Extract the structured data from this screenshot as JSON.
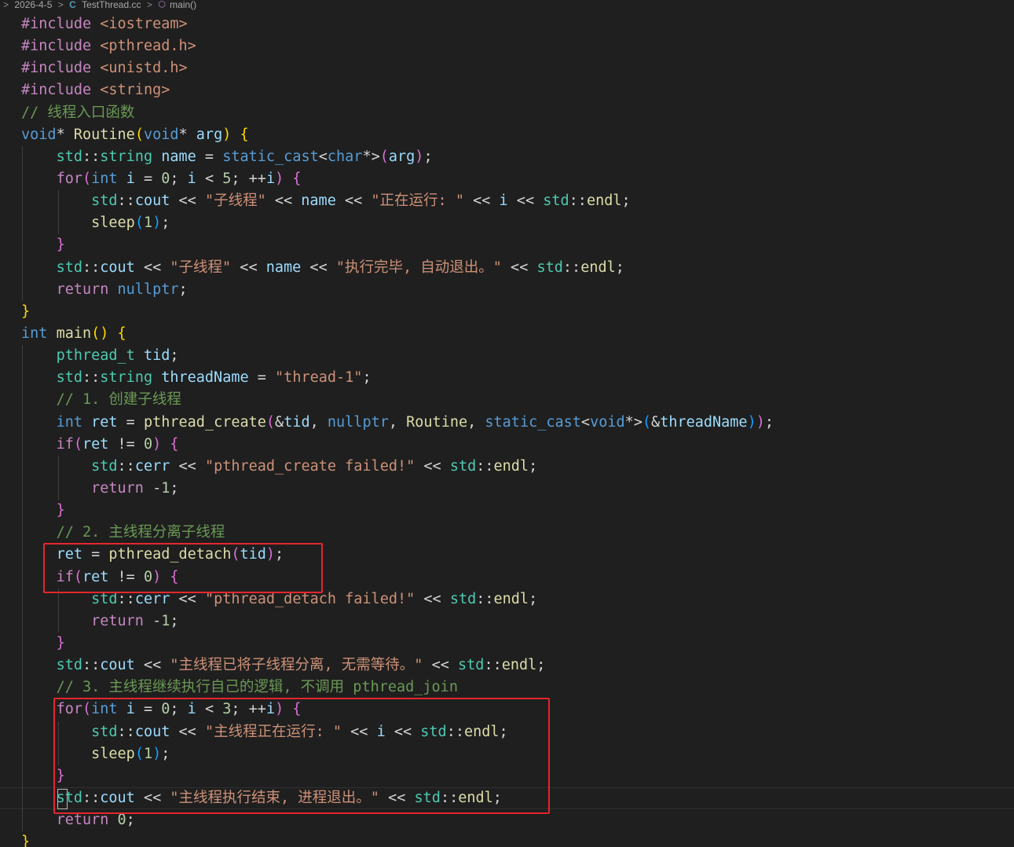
{
  "breadcrumb": {
    "items": [
      "2026-4-5",
      "TestThread.cc",
      "main()"
    ],
    "separator": ">"
  },
  "colors": {
    "background": "#1f1f1f",
    "highlight_box": "#e5262d",
    "comment": "#6a9955",
    "string": "#ce9178",
    "keyword": "#569cd6",
    "type": "#4ec9b0",
    "function": "#dcdcaa",
    "variable": "#9cdcfe"
  },
  "editor": {
    "language": "cpp",
    "lines": [
      {
        "indent": 0,
        "tokens": [
          [
            "pre",
            "#include "
          ],
          [
            "str",
            "<iostream>"
          ]
        ]
      },
      {
        "indent": 0,
        "tokens": [
          [
            "pre",
            "#include "
          ],
          [
            "str",
            "<pthread.h>"
          ]
        ]
      },
      {
        "indent": 0,
        "tokens": [
          [
            "pre",
            "#include "
          ],
          [
            "str",
            "<unistd.h>"
          ]
        ]
      },
      {
        "indent": 0,
        "tokens": [
          [
            "pre",
            "#include "
          ],
          [
            "str",
            "<string>"
          ]
        ]
      },
      {
        "indent": 0,
        "tokens": [
          [
            "cmt",
            "// 线程入口函数"
          ]
        ]
      },
      {
        "indent": 0,
        "tokens": [
          [
            "kw",
            "void"
          ],
          [
            "op",
            "* "
          ],
          [
            "fn",
            "Routine"
          ],
          [
            "p1",
            "("
          ],
          [
            "kw",
            "void"
          ],
          [
            "op",
            "* "
          ],
          [
            "var",
            "arg"
          ],
          [
            "p1",
            ")"
          ],
          [
            "pl",
            " "
          ],
          [
            "p1",
            "{"
          ]
        ]
      },
      {
        "indent": 1,
        "tokens": [
          [
            "type",
            "std"
          ],
          [
            "op",
            "::"
          ],
          [
            "type",
            "string"
          ],
          [
            "pl",
            " "
          ],
          [
            "var",
            "name"
          ],
          [
            "op",
            " = "
          ],
          [
            "kw",
            "static_cast"
          ],
          [
            "op",
            "<"
          ],
          [
            "kw",
            "char"
          ],
          [
            "op",
            "*>"
          ],
          [
            "p2",
            "("
          ],
          [
            "var",
            "arg"
          ],
          [
            "p2",
            ")"
          ],
          [
            "pl",
            ";"
          ]
        ]
      },
      {
        "indent": 1,
        "tokens": [
          [
            "ctl",
            "for"
          ],
          [
            "p2",
            "("
          ],
          [
            "kw",
            "int"
          ],
          [
            "pl",
            " "
          ],
          [
            "var",
            "i"
          ],
          [
            "op",
            " = "
          ],
          [
            "num",
            "0"
          ],
          [
            "pl",
            "; "
          ],
          [
            "var",
            "i"
          ],
          [
            "op",
            " < "
          ],
          [
            "num",
            "5"
          ],
          [
            "pl",
            "; "
          ],
          [
            "op",
            "++"
          ],
          [
            "var",
            "i"
          ],
          [
            "p2",
            ")"
          ],
          [
            "pl",
            " "
          ],
          [
            "p2",
            "{"
          ]
        ]
      },
      {
        "indent": 2,
        "tokens": [
          [
            "type",
            "std"
          ],
          [
            "op",
            "::"
          ],
          [
            "var",
            "cout"
          ],
          [
            "op",
            " << "
          ],
          [
            "str",
            "\"子线程\""
          ],
          [
            "op",
            " << "
          ],
          [
            "var",
            "name"
          ],
          [
            "op",
            " << "
          ],
          [
            "str",
            "\"正在运行: \""
          ],
          [
            "op",
            " << "
          ],
          [
            "var",
            "i"
          ],
          [
            "op",
            " << "
          ],
          [
            "type",
            "std"
          ],
          [
            "op",
            "::"
          ],
          [
            "fn",
            "endl"
          ],
          [
            "pl",
            ";"
          ]
        ]
      },
      {
        "indent": 2,
        "tokens": [
          [
            "fn",
            "sleep"
          ],
          [
            "p3",
            "("
          ],
          [
            "num",
            "1"
          ],
          [
            "p3",
            ")"
          ],
          [
            "pl",
            ";"
          ]
        ]
      },
      {
        "indent": 1,
        "tokens": [
          [
            "p2",
            "}"
          ]
        ]
      },
      {
        "indent": 1,
        "tokens": [
          [
            "type",
            "std"
          ],
          [
            "op",
            "::"
          ],
          [
            "var",
            "cout"
          ],
          [
            "op",
            " << "
          ],
          [
            "str",
            "\"子线程\""
          ],
          [
            "op",
            " << "
          ],
          [
            "var",
            "name"
          ],
          [
            "op",
            " << "
          ],
          [
            "str",
            "\"执行完毕, 自动退出。\""
          ],
          [
            "op",
            " << "
          ],
          [
            "type",
            "std"
          ],
          [
            "op",
            "::"
          ],
          [
            "fn",
            "endl"
          ],
          [
            "pl",
            ";"
          ]
        ]
      },
      {
        "indent": 1,
        "tokens": [
          [
            "ctl",
            "return"
          ],
          [
            "pl",
            " "
          ],
          [
            "kw",
            "nullptr"
          ],
          [
            "pl",
            ";"
          ]
        ]
      },
      {
        "indent": 0,
        "tokens": [
          [
            "p1",
            "}"
          ]
        ]
      },
      {
        "indent": 0,
        "tokens": [
          [
            "kw",
            "int"
          ],
          [
            "pl",
            " "
          ],
          [
            "fn",
            "main"
          ],
          [
            "p1",
            "()"
          ],
          [
            "pl",
            " "
          ],
          [
            "p1",
            "{"
          ]
        ]
      },
      {
        "indent": 1,
        "tokens": [
          [
            "type",
            "pthread_t"
          ],
          [
            "pl",
            " "
          ],
          [
            "var",
            "tid"
          ],
          [
            "pl",
            ";"
          ]
        ]
      },
      {
        "indent": 1,
        "tokens": [
          [
            "type",
            "std"
          ],
          [
            "op",
            "::"
          ],
          [
            "type",
            "string"
          ],
          [
            "pl",
            " "
          ],
          [
            "var",
            "threadName"
          ],
          [
            "op",
            " = "
          ],
          [
            "str",
            "\"thread-1\""
          ],
          [
            "pl",
            ";"
          ]
        ]
      },
      {
        "indent": 1,
        "tokens": [
          [
            "cmt",
            "// 1. 创建子线程"
          ]
        ]
      },
      {
        "indent": 1,
        "tokens": [
          [
            "kw",
            "int"
          ],
          [
            "pl",
            " "
          ],
          [
            "var",
            "ret"
          ],
          [
            "op",
            " = "
          ],
          [
            "fn",
            "pthread_create"
          ],
          [
            "p2",
            "("
          ],
          [
            "op",
            "&"
          ],
          [
            "var",
            "tid"
          ],
          [
            "pl",
            ", "
          ],
          [
            "kw",
            "nullptr"
          ],
          [
            "pl",
            ", "
          ],
          [
            "fn",
            "Routine"
          ],
          [
            "pl",
            ", "
          ],
          [
            "kw",
            "static_cast"
          ],
          [
            "op",
            "<"
          ],
          [
            "kw",
            "void"
          ],
          [
            "op",
            "*>"
          ],
          [
            "p3",
            "("
          ],
          [
            "op",
            "&"
          ],
          [
            "var",
            "threadName"
          ],
          [
            "p3",
            ")"
          ],
          [
            "p2",
            ")"
          ],
          [
            "pl",
            ";"
          ]
        ]
      },
      {
        "indent": 1,
        "tokens": [
          [
            "ctl",
            "if"
          ],
          [
            "p2",
            "("
          ],
          [
            "var",
            "ret"
          ],
          [
            "op",
            " != "
          ],
          [
            "num",
            "0"
          ],
          [
            "p2",
            ")"
          ],
          [
            "pl",
            " "
          ],
          [
            "p2",
            "{"
          ]
        ]
      },
      {
        "indent": 2,
        "tokens": [
          [
            "type",
            "std"
          ],
          [
            "op",
            "::"
          ],
          [
            "var",
            "cerr"
          ],
          [
            "op",
            " << "
          ],
          [
            "str",
            "\"pthread_create failed!\""
          ],
          [
            "op",
            " << "
          ],
          [
            "type",
            "std"
          ],
          [
            "op",
            "::"
          ],
          [
            "fn",
            "endl"
          ],
          [
            "pl",
            ";"
          ]
        ]
      },
      {
        "indent": 2,
        "tokens": [
          [
            "ctl",
            "return"
          ],
          [
            "pl",
            " "
          ],
          [
            "op",
            "-"
          ],
          [
            "num",
            "1"
          ],
          [
            "pl",
            ";"
          ]
        ]
      },
      {
        "indent": 1,
        "tokens": [
          [
            "p2",
            "}"
          ]
        ]
      },
      {
        "indent": 1,
        "tokens": [
          [
            "cmt",
            "// 2. 主线程分离子线程"
          ]
        ]
      },
      {
        "indent": 1,
        "tokens": [
          [
            "var",
            "ret"
          ],
          [
            "op",
            " = "
          ],
          [
            "fn",
            "pthread_detach"
          ],
          [
            "p2",
            "("
          ],
          [
            "var",
            "tid"
          ],
          [
            "p2",
            ")"
          ],
          [
            "pl",
            ";"
          ]
        ]
      },
      {
        "indent": 1,
        "tokens": [
          [
            "ctl",
            "if"
          ],
          [
            "p2",
            "("
          ],
          [
            "var",
            "ret"
          ],
          [
            "op",
            " != "
          ],
          [
            "num",
            "0"
          ],
          [
            "p2",
            ")"
          ],
          [
            "pl",
            " "
          ],
          [
            "p2",
            "{"
          ]
        ]
      },
      {
        "indent": 2,
        "tokens": [
          [
            "type",
            "std"
          ],
          [
            "op",
            "::"
          ],
          [
            "var",
            "cerr"
          ],
          [
            "op",
            " << "
          ],
          [
            "str",
            "\"pthread_detach failed!\""
          ],
          [
            "op",
            " << "
          ],
          [
            "type",
            "std"
          ],
          [
            "op",
            "::"
          ],
          [
            "fn",
            "endl"
          ],
          [
            "pl",
            ";"
          ]
        ]
      },
      {
        "indent": 2,
        "tokens": [
          [
            "ctl",
            "return"
          ],
          [
            "pl",
            " "
          ],
          [
            "op",
            "-"
          ],
          [
            "num",
            "1"
          ],
          [
            "pl",
            ";"
          ]
        ]
      },
      {
        "indent": 1,
        "tokens": [
          [
            "p2",
            "}"
          ]
        ]
      },
      {
        "indent": 1,
        "tokens": [
          [
            "type",
            "std"
          ],
          [
            "op",
            "::"
          ],
          [
            "var",
            "cout"
          ],
          [
            "op",
            " << "
          ],
          [
            "str",
            "\"主线程已将子线程分离, 无需等待。\""
          ],
          [
            "op",
            " << "
          ],
          [
            "type",
            "std"
          ],
          [
            "op",
            "::"
          ],
          [
            "fn",
            "endl"
          ],
          [
            "pl",
            ";"
          ]
        ]
      },
      {
        "indent": 1,
        "tokens": [
          [
            "cmt",
            "// 3. 主线程继续执行自己的逻辑, 不调用 pthread_join"
          ]
        ]
      },
      {
        "indent": 1,
        "tokens": [
          [
            "ctl",
            "for"
          ],
          [
            "p2",
            "("
          ],
          [
            "kw",
            "int"
          ],
          [
            "pl",
            " "
          ],
          [
            "var",
            "i"
          ],
          [
            "op",
            " = "
          ],
          [
            "num",
            "0"
          ],
          [
            "pl",
            "; "
          ],
          [
            "var",
            "i"
          ],
          [
            "op",
            " < "
          ],
          [
            "num",
            "3"
          ],
          [
            "pl",
            "; "
          ],
          [
            "op",
            "++"
          ],
          [
            "var",
            "i"
          ],
          [
            "p2",
            ")"
          ],
          [
            "pl",
            " "
          ],
          [
            "p2",
            "{"
          ]
        ]
      },
      {
        "indent": 2,
        "tokens": [
          [
            "type",
            "std"
          ],
          [
            "op",
            "::"
          ],
          [
            "var",
            "cout"
          ],
          [
            "op",
            " << "
          ],
          [
            "str",
            "\"主线程正在运行: \""
          ],
          [
            "op",
            " << "
          ],
          [
            "var",
            "i"
          ],
          [
            "op",
            " << "
          ],
          [
            "type",
            "std"
          ],
          [
            "op",
            "::"
          ],
          [
            "fn",
            "endl"
          ],
          [
            "pl",
            ";"
          ]
        ]
      },
      {
        "indent": 2,
        "tokens": [
          [
            "fn",
            "sleep"
          ],
          [
            "p3",
            "("
          ],
          [
            "num",
            "1"
          ],
          [
            "p3",
            ")"
          ],
          [
            "pl",
            ";"
          ]
        ]
      },
      {
        "indent": 1,
        "tokens": [
          [
            "p2",
            "}"
          ]
        ]
      },
      {
        "indent": 1,
        "tokens": [
          [
            "type",
            "std"
          ],
          [
            "op",
            "::"
          ],
          [
            "var",
            "cout"
          ],
          [
            "op",
            " << "
          ],
          [
            "str",
            "\"主线程执行结束, 进程退出。\""
          ],
          [
            "op",
            " << "
          ],
          [
            "type",
            "std"
          ],
          [
            "op",
            "::"
          ],
          [
            "fn",
            "endl"
          ],
          [
            "pl",
            ";"
          ]
        ]
      },
      {
        "indent": 1,
        "tokens": [
          [
            "ctl",
            "return"
          ],
          [
            "pl",
            " "
          ],
          [
            "num",
            "0"
          ],
          [
            "pl",
            ";"
          ]
        ]
      },
      {
        "indent": 0,
        "tokens": [
          [
            "p1",
            "}"
          ]
        ]
      }
    ],
    "current_line": 35,
    "highlight_boxes": [
      {
        "from_line": 24,
        "to_line": 25
      },
      {
        "from_line": 31,
        "to_line": 35
      }
    ]
  }
}
